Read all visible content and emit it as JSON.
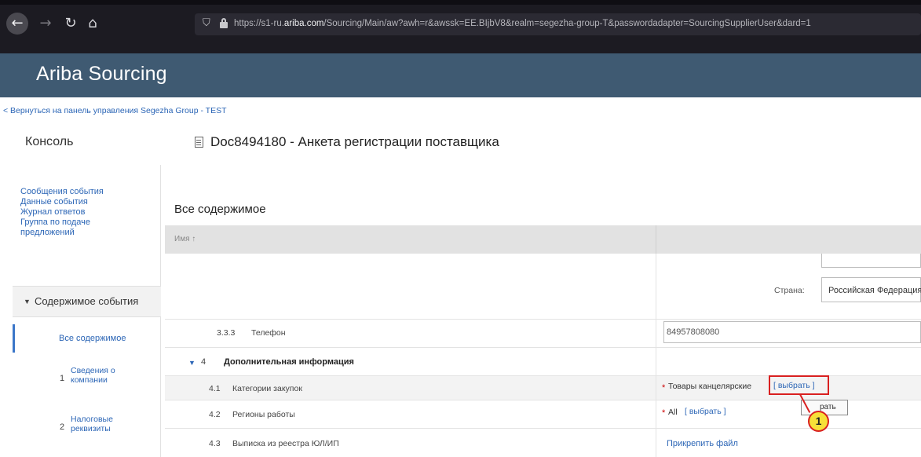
{
  "browser": {
    "url_prefix": "https://s1-ru.",
    "url_domain": "ariba.com",
    "url_rest": "/Sourcing/Main/aw?awh=r&awssk=EE.BIjbV8&realm=segezha-group-T&passwordadapter=SourcingSupplierUser&dard=1"
  },
  "app": {
    "title": "Ariba Sourcing"
  },
  "nav": {
    "back_link": "< Вернуться на панель управления Segezha Group - TEST"
  },
  "console_title": "Консоль",
  "document_title": "Doc8494180 - Анкета регистрации поставщика",
  "sidebar": {
    "links": [
      "Сообщения события",
      "Данные события",
      "Журнал ответов",
      "Группа по подаче предложений"
    ],
    "section_label": "Содержимое события",
    "active_item": "Все содержимое",
    "items": [
      {
        "num": "1",
        "label": "Сведения о компании"
      },
      {
        "num": "2",
        "label": "Налоговые реквизиты"
      }
    ]
  },
  "main": {
    "section_title": "Все содержимое",
    "column_name": "Имя ↑",
    "country_label": "Страна:",
    "country_value": "Российская Федерация",
    "rows": {
      "phone": {
        "num": "3.3.3",
        "label": "Телефон",
        "value": "84957808080"
      },
      "group": {
        "num": "4",
        "label": "Дополнительная информация"
      },
      "categories": {
        "num": "4.1",
        "label": "Категории закупок",
        "value": "Товары канцелярские",
        "action": "[ выбрать ]"
      },
      "regions": {
        "num": "4.2",
        "label": "Регионы работы",
        "value": "All",
        "action": "[ выбрать ]"
      },
      "extract": {
        "num": "4.3",
        "label": "Выписка из реестра ЮЛ/ИП",
        "action": "Прикрепить файл"
      }
    },
    "tooltip_text": "рать",
    "callout_number": "1"
  }
}
